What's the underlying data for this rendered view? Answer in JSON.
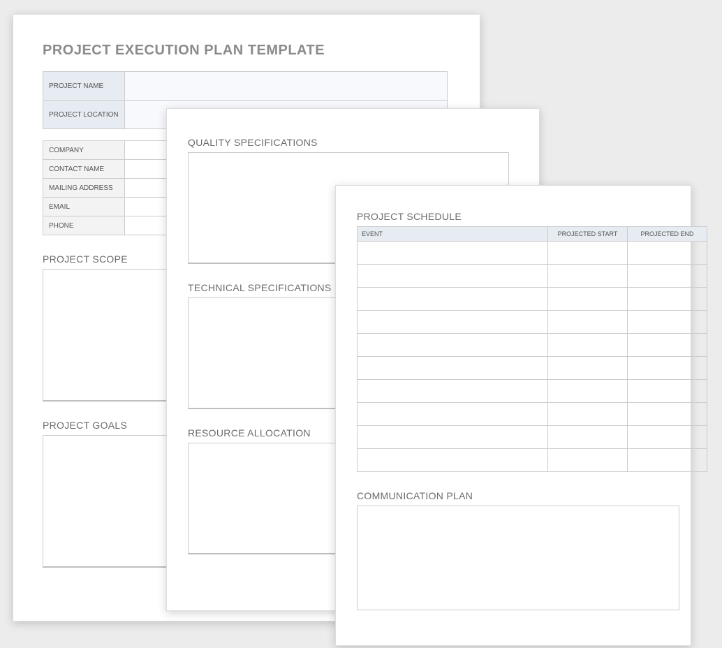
{
  "page1": {
    "title": "PROJECT EXECUTION PLAN TEMPLATE",
    "top_labels": {
      "name": "PROJECT NAME",
      "location": "PROJECT LOCATION"
    },
    "top_values": {
      "name": "",
      "location": ""
    },
    "info_labels": {
      "company": "COMPANY",
      "contact": "CONTACT NAME",
      "mail": "MAILING ADDRESS",
      "email": "EMAIL",
      "phone": "PHONE"
    },
    "info_values": {
      "company": "",
      "contact": "",
      "mail": "",
      "email": "",
      "phone": ""
    },
    "scope_heading": "PROJECT SCOPE",
    "goals_heading": "PROJECT GOALS"
  },
  "page2": {
    "quality_heading": "QUALITY SPECIFICATIONS",
    "technical_heading": "TECHNICAL SPECIFICATIONS",
    "resource_heading": "RESOURCE ALLOCATION"
  },
  "page3": {
    "schedule_heading": "PROJECT SCHEDULE",
    "cols": {
      "event": "EVENT",
      "start": "PROJECTED START",
      "end": "PROJECTED END"
    },
    "rows": [
      "",
      "",
      "",
      "",
      "",
      "",
      "",
      "",
      "",
      ""
    ],
    "comm_heading": "COMMUNICATION PLAN"
  }
}
